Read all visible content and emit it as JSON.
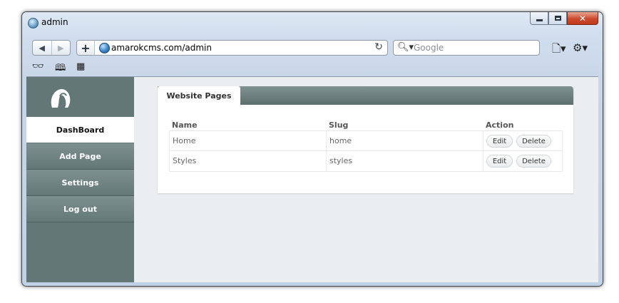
{
  "window": {
    "title": "admin"
  },
  "toolbar": {
    "url": "amarokcms.com/admin",
    "search_placeholder": "Google",
    "back_icon": "back-arrow-icon",
    "forward_icon": "forward-arrow-icon"
  },
  "bookmarks": [
    "reader-icon",
    "bookmarks-book-icon",
    "apps-grid-icon"
  ],
  "sidebar": {
    "items": [
      {
        "label": "DashBoard",
        "active": true
      },
      {
        "label": "Add Page",
        "active": false
      },
      {
        "label": "Settings",
        "active": false
      },
      {
        "label": "Log out",
        "active": false
      }
    ]
  },
  "panel": {
    "tab": "Website Pages",
    "columns": [
      "Name",
      "Slug",
      "Action"
    ],
    "rows": [
      {
        "name": "Home",
        "slug": "home",
        "edit": "Edit",
        "delete": "Delete"
      },
      {
        "name": "Styles",
        "slug": "styles",
        "edit": "Edit",
        "delete": "Delete"
      }
    ]
  },
  "colors": {
    "sidebar": "#637776",
    "panel_header": "#6f8281",
    "close_button": "#c94a2e",
    "content_bg": "#eaeef0"
  }
}
